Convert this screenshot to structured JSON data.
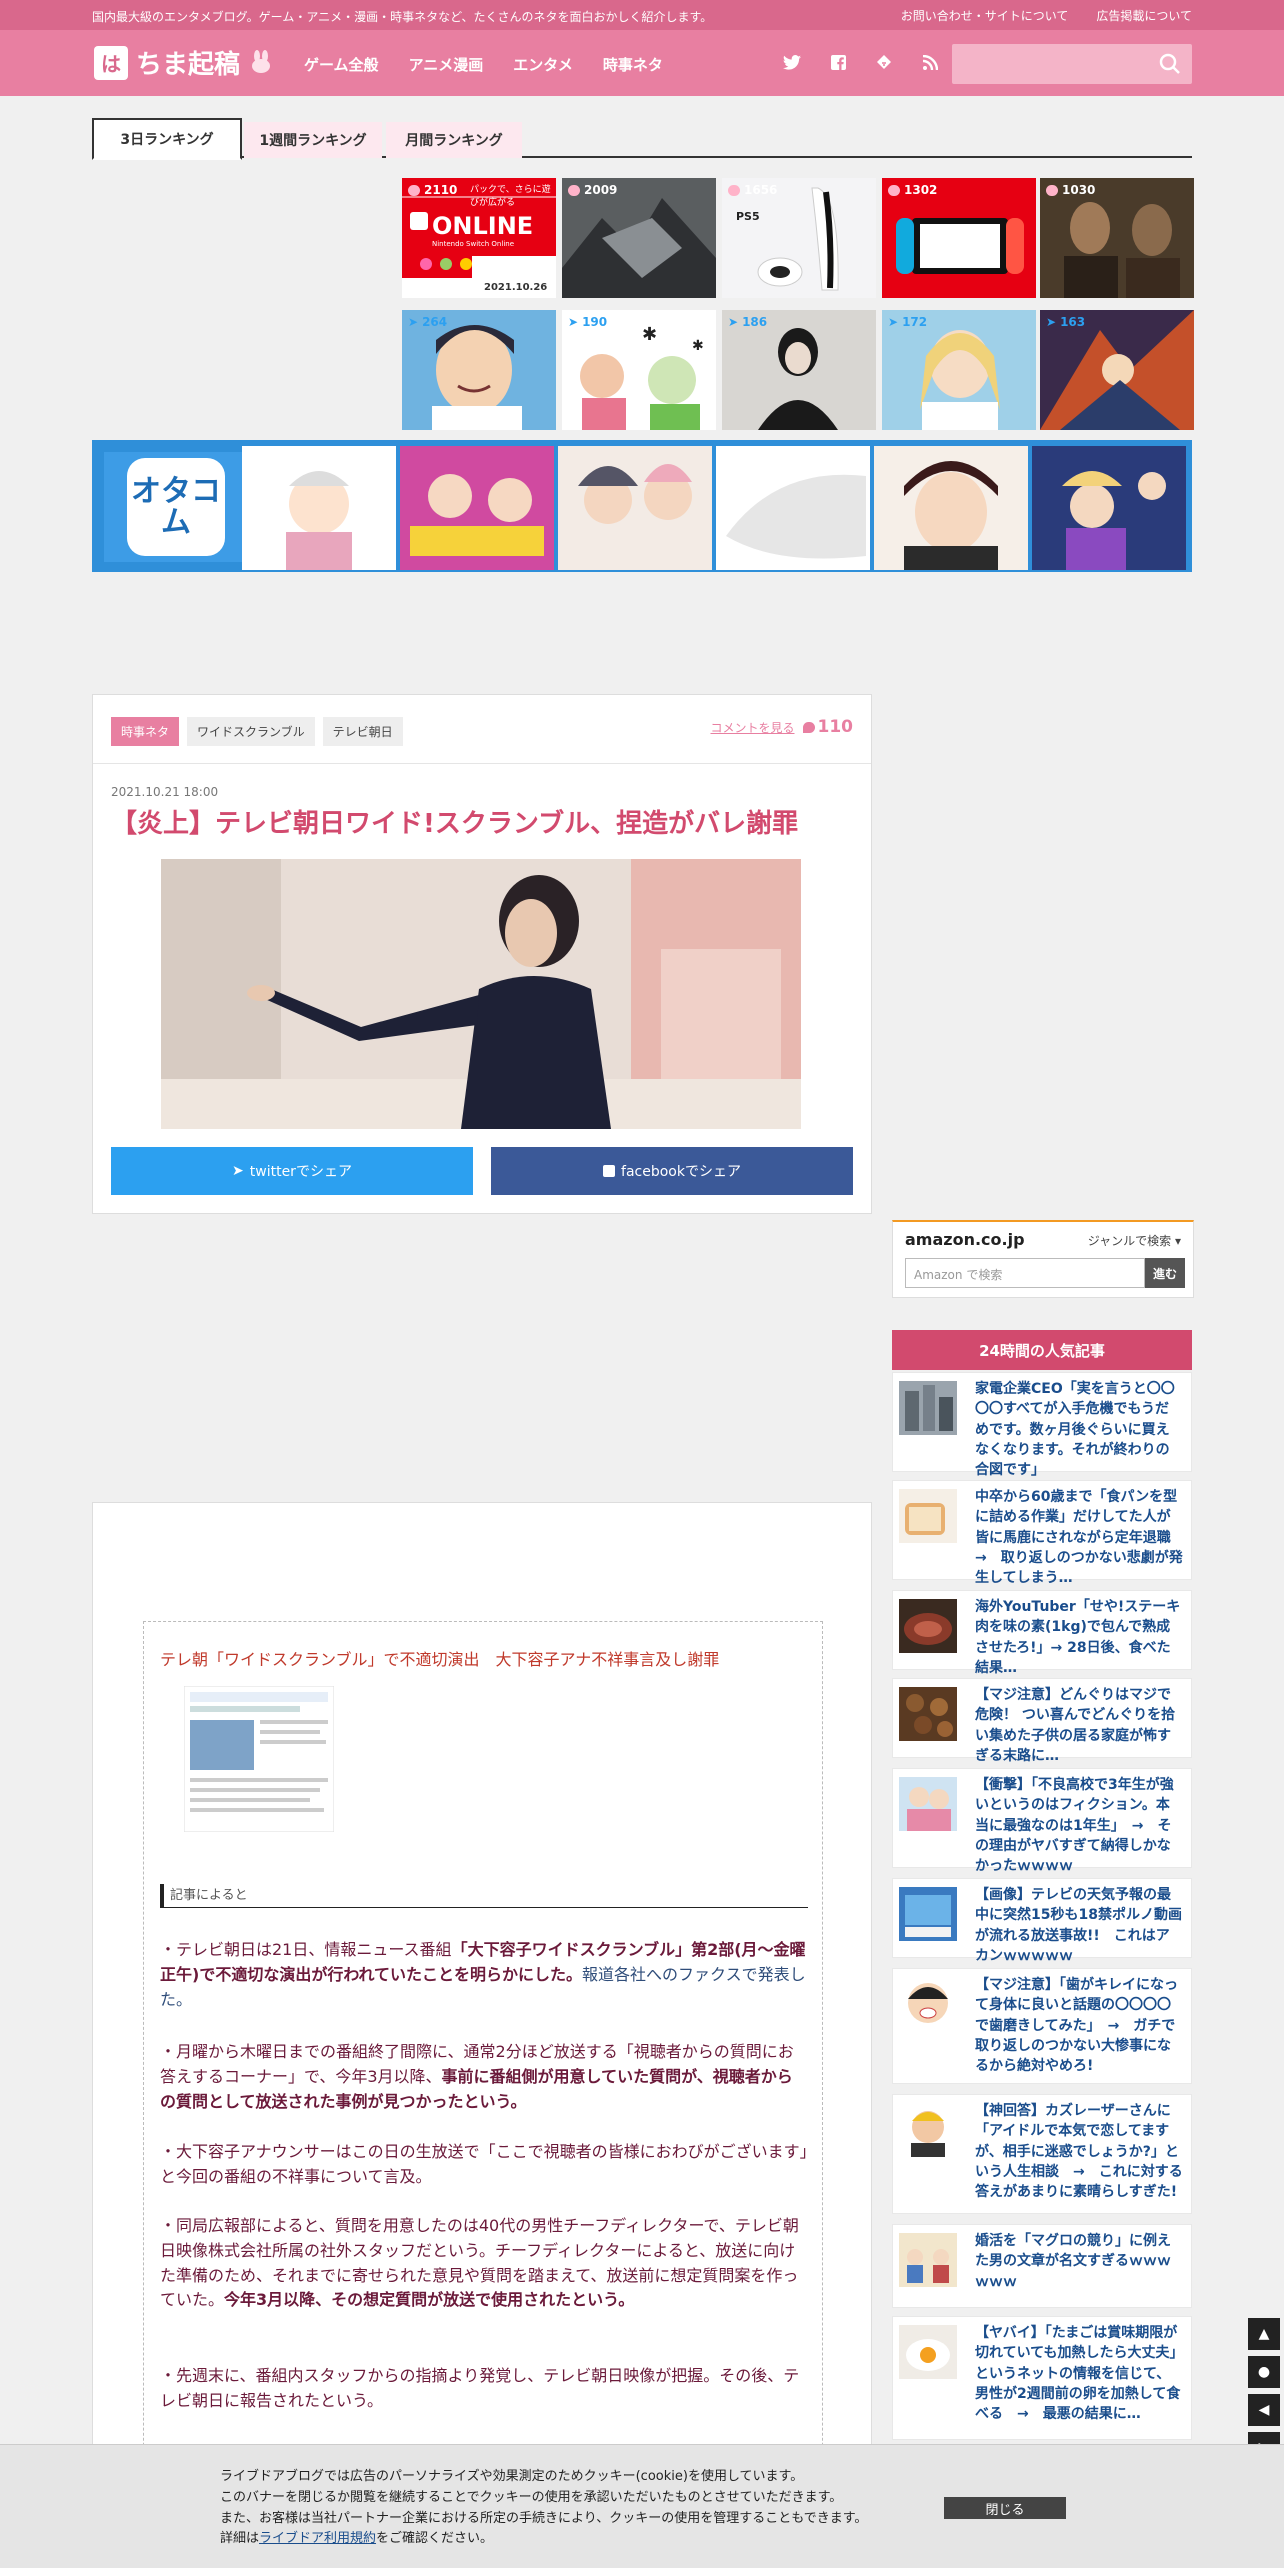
{
  "topbar": {
    "tagline": "国内最大級のエンタメブログ。ゲーム・アニメ・漫画・時事ネタなど、たくさんのネタを面白おかしく紹介します。",
    "links": [
      "お問い合わせ・サイトについて",
      "広告掲載について"
    ]
  },
  "header": {
    "logo_mark": "は",
    "logo_text": "ちま起稿",
    "nav": [
      "ゲーム全般",
      "アニメ漫画",
      "エンタメ",
      "時事ネタ"
    ],
    "social_icons": [
      "twitter-icon",
      "facebook-icon",
      "feedly-icon",
      "rss-icon"
    ],
    "search_icon": "search-icon"
  },
  "ranking": {
    "tabs": [
      "3日ランキング",
      "1週間ランキング",
      "月間ランキング"
    ],
    "active_tab": "3日ランキング",
    "row1": [
      {
        "count": "2110",
        "icon": "comment-icon"
      },
      {
        "count": "2009",
        "icon": "comment-icon"
      },
      {
        "count": "1656",
        "icon": "comment-icon"
      },
      {
        "count": "1302",
        "icon": "comment-icon"
      },
      {
        "count": "1030",
        "icon": "comment-icon"
      }
    ],
    "row2": [
      {
        "count": "264",
        "icon": "twitter-icon"
      },
      {
        "count": "190",
        "icon": "twitter-icon"
      },
      {
        "count": "186",
        "icon": "twitter-icon"
      },
      {
        "count": "172",
        "icon": "twitter-icon"
      },
      {
        "count": "163",
        "icon": "twitter-icon"
      }
    ],
    "thumb1_text": "パックで、さらに遊びが広がる",
    "thumb1_brand": "ONLINE",
    "thumb1_sub": "Nintendo Switch Online",
    "thumb1_date": "2021.10.26",
    "thumb3_text": "PS5"
  },
  "banner": {
    "logo_text": "オタコム"
  },
  "article": {
    "tags": [
      "時事ネタ",
      "ワイドスクランブル",
      "テレビ朝日"
    ],
    "comment_link": "コメントを見る",
    "comment_count": "110",
    "date": "2021.10.21 18:00",
    "title": "【炎上】テレビ朝日ワイド!スクランブル、捏造がバレ謝罪",
    "share_twitter": "twitterでシェア",
    "share_facebook": "facebookでシェア"
  },
  "amazon": {
    "logo": "amazon.co.jp",
    "genre": "ジャンルで検索",
    "placeholder": "Amazon で検索",
    "go": "進む"
  },
  "popular": {
    "heading": "24時間の人気記事",
    "items": [
      "家電企業CEO「実を言うと〇〇〇〇すべてが入手危機でもうだめです。数ヶ月後ぐらいに買えなくなります。それが終わりの合図です」",
      "中卒から60歳まで「食パンを型に詰める作業」だけしてた人が皆に馬鹿にされながら定年退職　→　取り返しのつかない悲劇が発生してしまう…",
      "海外YouTuber「せや!ステーキ肉を味の素(1kg)で包んで熟成させたろ!」→ 28日後、食べた結果…",
      "【マジ注意】どんぐりはマジで危険！ つい喜んでどんぐりを拾い集めた子供の居る家庭が怖すぎる末路に…",
      "【衝撃】「不良高校で3年生が強いというのはフィクション。本当に最強なのは1年生」　→　その理由がヤバすぎて納得しかなかったｗｗｗｗ",
      "【画像】テレビの天気予報の最中に突然15秒も18禁ポルノ動画が流れる放送事故!!　これはアカンｗｗｗｗｗ",
      "【マジ注意】「歯がキレイになって身体に良いと話題の〇〇〇〇で歯磨きしてみた」　→　ガチで取り返しのつかない大惨事になるから絶対やめろ!",
      "【神回答】カズレーザーさんに「アイドルで本気で恋してますが、相手に迷惑でしょうか?」という人生相談　→　これに対する答えがあまりに素晴らしすぎた!",
      "婚活を「マグロの競り」に例えた男の文章が名文すぎるｗｗｗｗｗｗ",
      "【ヤバイ】「たまごは賞味期限が切れていても加熱したら大丈夫」というネットの情報を信じて、男性が2週間前の卵を加熱して食べる　→　最悪の結果に…"
    ]
  },
  "body": {
    "quote_title": "テレ朝「ワイドスクランブル」で不適切演出　大下容子アナ不祥事言及し謝罪",
    "kiji": "記事によると",
    "p1_a": "・テレビ朝日は21日、情報ニュース番組",
    "p1_b": "「大下容子ワイドスクランブル」第2部(月～金曜正午)で不適切な演出が行われていたことを明らかにした。",
    "p1_c": "報道各社へのファクスで発表した。",
    "p2_a": "・月曜から木曜日までの番組終了間際に、通常2分ほど放送する「視聴者からの質問にお答えするコーナー」で、今年3月以降、",
    "p2_b": "事前に番組側が用意していた質問が、視聴者からの質問として放送された事例が見つかったという。",
    "p3": "・大下容子アナウンサーはこの日の生放送で「ここで視聴者の皆様におわびがございます」と今回の番組の不祥事について言及。",
    "p4_a": "・同局広報部によると、質問を用意したのは40代の男性チーフディレクターで、テレビ朝日映像株式会社所属の社外スタッフだという。チーフディレクターによると、放送に向けた準備のため、それまでに寄せられた意見や質問を踏まえて、放送前に想定質問案を作っていた。",
    "p4_b": "今年3月以降、その想定質問が放送で使用されたという。",
    "p5": "・先週末に、番組内スタッフからの指摘より発覚し、テレビ朝日映像が把握。その後、テレビ朝日に報告されたという。"
  },
  "cookie": {
    "line1": "ライブドアブログでは広告のパーソナライズや効果測定のためクッキー(cookie)を使用しています。",
    "line2": "このバナーを閉じるか閲覧を継続することでクッキーの使用を承認いただいたものとさせていただきます。",
    "line3": "また、お客様は当社パートナー企業における所定の手続きにより、クッキーの使用を管理することもできます。",
    "line4_a": "詳細は",
    "line4_link": "ライブドア利用規約",
    "line4_b": "をご確認ください。",
    "close": "閉じる"
  },
  "float_buttons": [
    "arrow-up-icon",
    "comment-icon",
    "arrow-left-icon",
    "arrow-right-icon"
  ],
  "colors": {
    "brand_pink": "#e87fa1",
    "dark_pink": "#d24a6e",
    "twitter_blue": "#2ca0f0",
    "facebook_blue": "#3b5998"
  }
}
